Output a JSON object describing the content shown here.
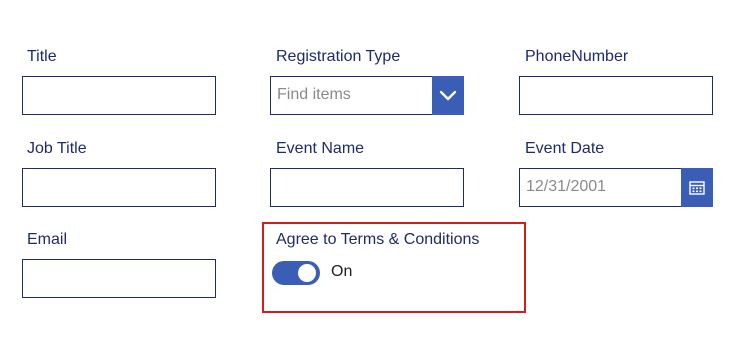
{
  "fields": {
    "title": {
      "label": "Title",
      "value": ""
    },
    "registration_type": {
      "label": "Registration Type",
      "placeholder": "Find items"
    },
    "phone_number": {
      "label": "PhoneNumber",
      "value": ""
    },
    "job_title": {
      "label": "Job Title",
      "value": ""
    },
    "event_name": {
      "label": "Event Name",
      "value": ""
    },
    "event_date": {
      "label": "Event Date",
      "value": "12/31/2001"
    },
    "email": {
      "label": "Email",
      "value": ""
    },
    "agree_terms": {
      "label": "Agree to Terms & Conditions",
      "state_label": "On",
      "checked": true
    }
  },
  "icons": {
    "dropdown": "chevron-down-icon",
    "calendar": "calendar-icon"
  },
  "colors": {
    "label_text": "#1f2a6b",
    "border": "#1f2a6b",
    "accent": "#3a5eb5",
    "highlight": "#d21d1d",
    "placeholder": "#8a8a8a"
  }
}
